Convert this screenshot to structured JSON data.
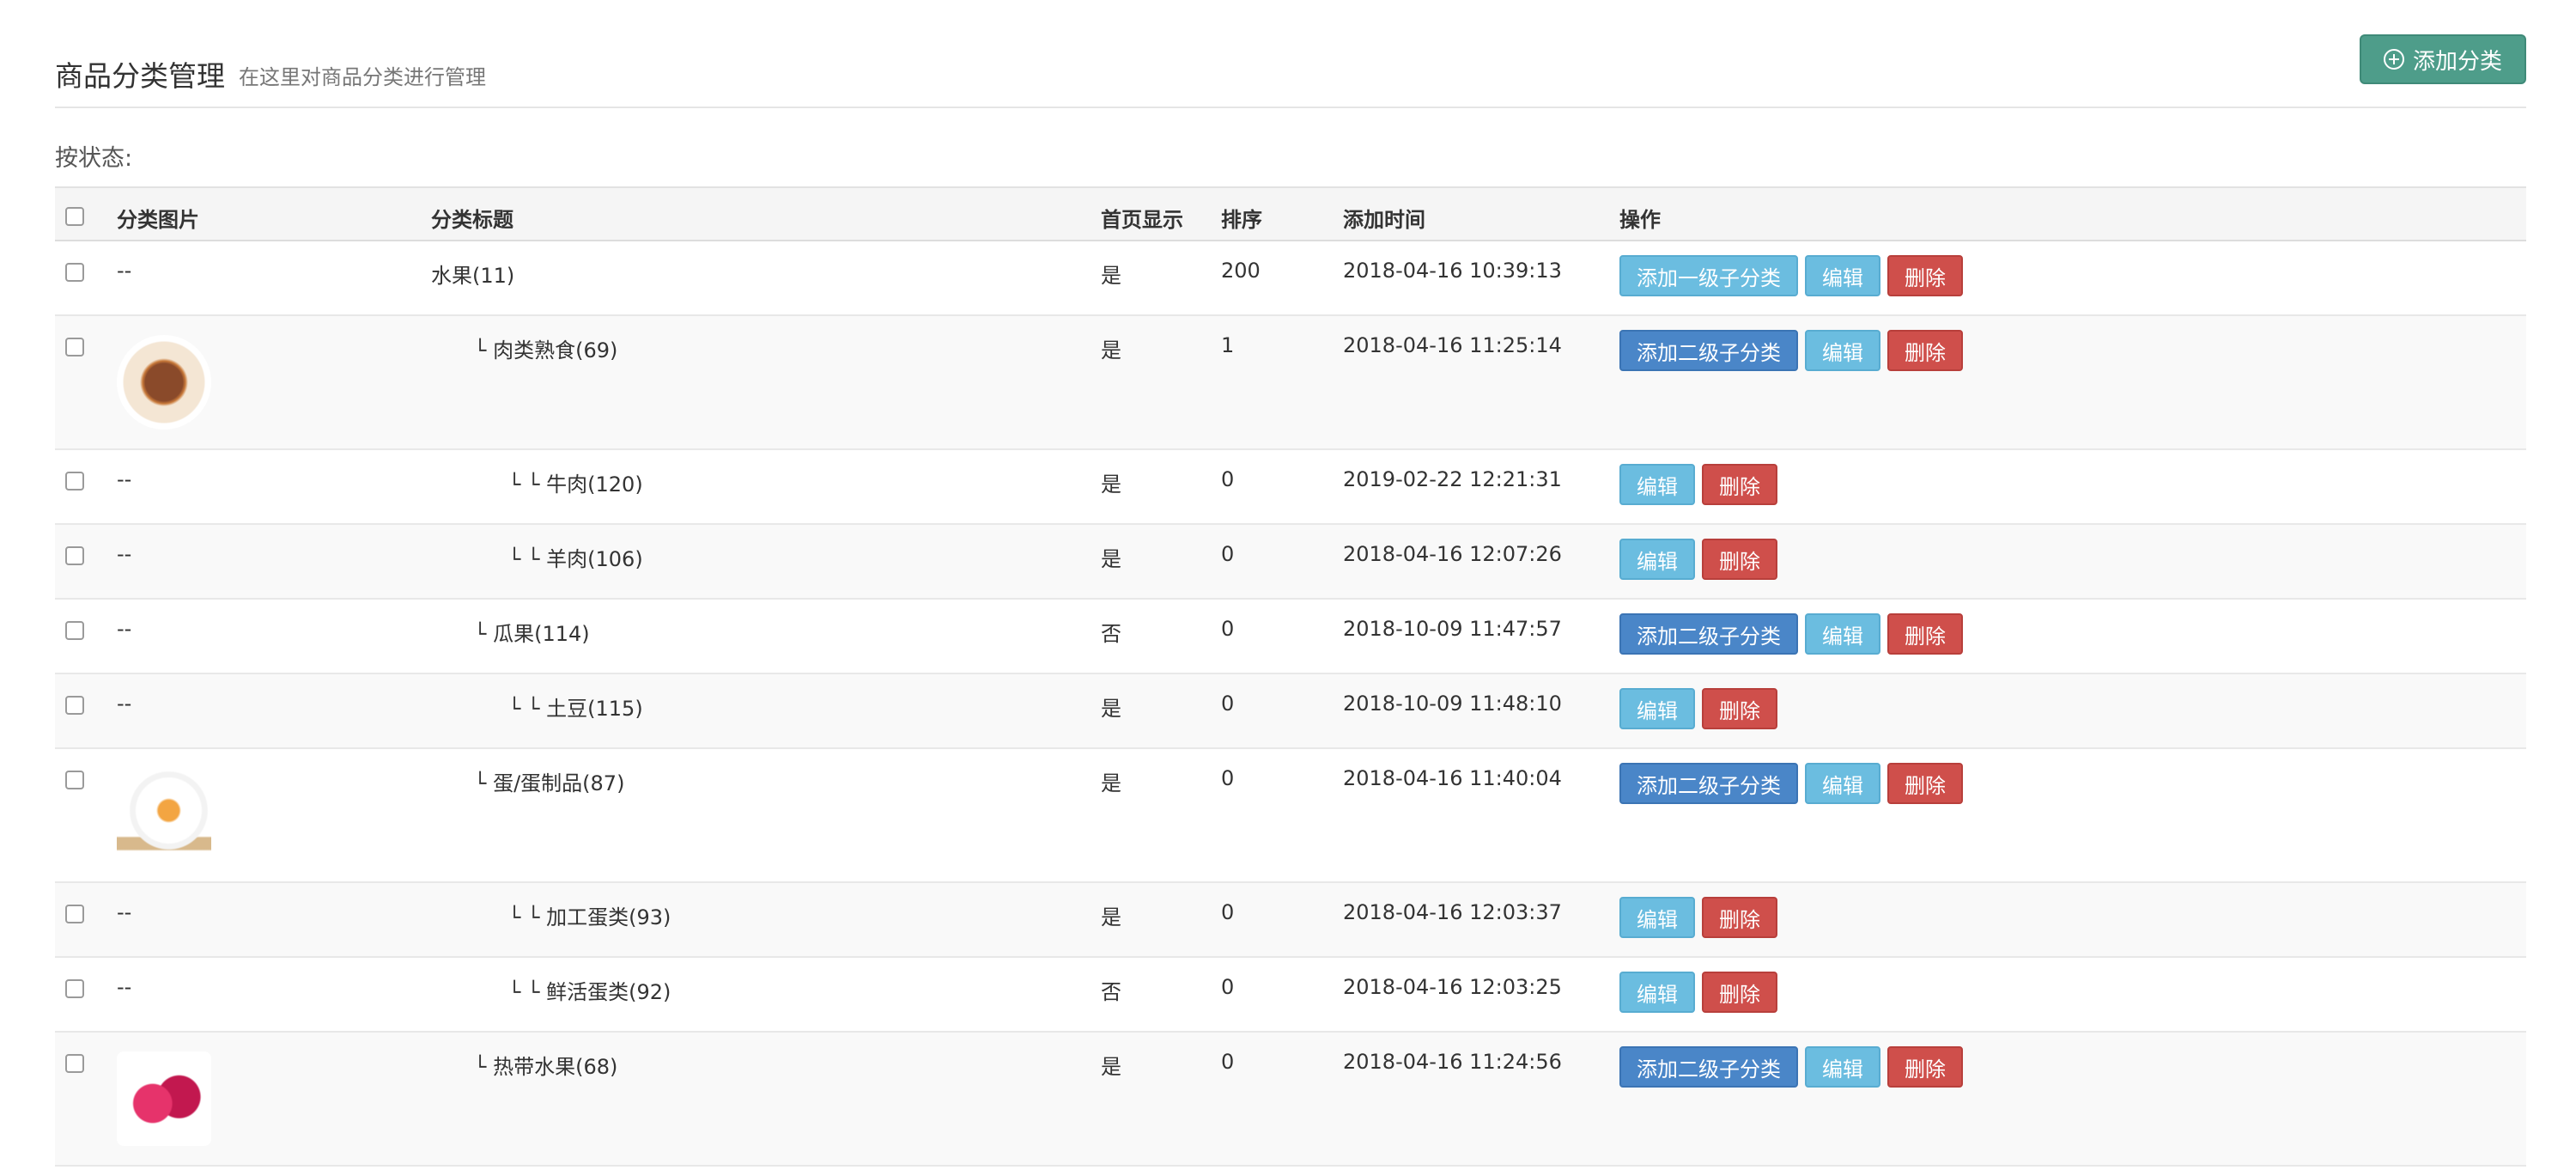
{
  "header": {
    "title": "商品分类管理",
    "subtitle": "在这里对商品分类进行管理",
    "add_button_label": "添加分类"
  },
  "filter": {
    "label": "按状态:"
  },
  "table": {
    "columns": [
      "分类图片",
      "分类标题",
      "首页显示",
      "排序",
      "添加时间",
      "操作"
    ],
    "rows": [
      {
        "image": "--",
        "title": "水果(11)",
        "show": "是",
        "sort": "200",
        "time": "2018-04-16 10:39:13",
        "add_label": "添加一级子分类",
        "edit": "编辑",
        "del": "删除"
      },
      {
        "image": "",
        "thumb": "meat",
        "title": "└ 肉类熟食(69)",
        "show": "是",
        "sort": "1",
        "time": "2018-04-16 11:25:14",
        "add_label": "添加二级子分类",
        "edit": "编辑",
        "del": "删除"
      },
      {
        "image": "--",
        "title": "└ └ 牛肉(120)",
        "show": "是",
        "sort": "0",
        "time": "2019-02-22 12:21:31",
        "edit": "编辑",
        "del": "删除"
      },
      {
        "image": "--",
        "title": "└ └ 羊肉(106)",
        "show": "是",
        "sort": "0",
        "time": "2018-04-16 12:07:26",
        "edit": "编辑",
        "del": "删除"
      },
      {
        "image": "--",
        "title": "└ 瓜果(114)",
        "show": "否",
        "sort": "0",
        "time": "2018-10-09 11:47:57",
        "add_label": "添加二级子分类",
        "edit": "编辑",
        "del": "删除"
      },
      {
        "image": "--",
        "title": "└ └ 土豆(115)",
        "show": "是",
        "sort": "0",
        "time": "2018-10-09 11:48:10",
        "edit": "编辑",
        "del": "删除"
      },
      {
        "image": "",
        "thumb": "egg",
        "title": "└ 蛋/蛋制品(87)",
        "show": "是",
        "sort": "0",
        "time": "2018-04-16 11:40:04",
        "add_label": "添加二级子分类",
        "edit": "编辑",
        "del": "删除"
      },
      {
        "image": "--",
        "title": "└ └ 加工蛋类(93)",
        "show": "是",
        "sort": "0",
        "time": "2018-04-16 12:03:37",
        "edit": "编辑",
        "del": "删除"
      },
      {
        "image": "--",
        "title": "└ └ 鲜活蛋类(92)",
        "show": "否",
        "sort": "0",
        "time": "2018-04-16 12:03:25",
        "edit": "编辑",
        "del": "删除"
      },
      {
        "image": "",
        "thumb": "fruit",
        "title": "└ 热带水果(68)",
        "show": "是",
        "sort": "0",
        "time": "2018-04-16 11:24:56",
        "add_label": "添加二级子分类",
        "edit": "编辑",
        "del": "删除"
      }
    ]
  },
  "colors": {
    "add_category": "#4e9d8a",
    "btn_info": "#6bbde0",
    "btn_primary": "#4a86c8",
    "btn_danger": "#cf4f4b"
  },
  "icons": {
    "add_category": "plus-circle-icon"
  }
}
